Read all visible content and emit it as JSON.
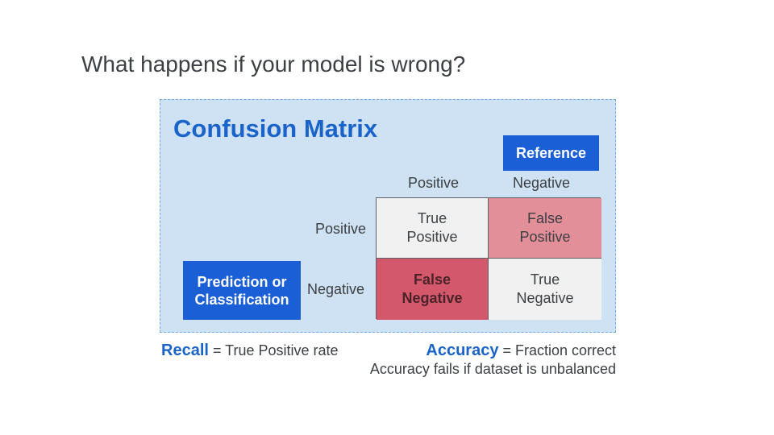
{
  "slide": {
    "title": "What happens if your model is wrong?"
  },
  "panel": {
    "title": "Confusion Matrix",
    "reference_label": "Reference",
    "prediction_label_line1": "Prediction or",
    "prediction_label_line2": "Classification"
  },
  "matrix": {
    "columns": [
      "Positive",
      "Negative"
    ],
    "rows": [
      "Positive",
      "Negative"
    ],
    "cells": {
      "tp": [
        "True",
        "Positive"
      ],
      "fp": [
        "False",
        "Positive"
      ],
      "fn": [
        "False",
        "Negative"
      ],
      "tn": [
        "True",
        "Negative"
      ]
    },
    "colors": {
      "tp": "#f1f1f1",
      "fp": "#e38f9a",
      "fn": "#d3586b",
      "tn": "#f1f1f1"
    }
  },
  "footer": {
    "recall_term": "Recall",
    "recall_def": " = True Positive rate",
    "accuracy_term": "Accuracy",
    "accuracy_def": " = Fraction correct",
    "accuracy_note": "Accuracy fails if dataset is unbalanced"
  },
  "colors": {
    "accent": "#1a63c9",
    "badge": "#1a5fd6",
    "panel_bg": "#cfe2f3"
  }
}
